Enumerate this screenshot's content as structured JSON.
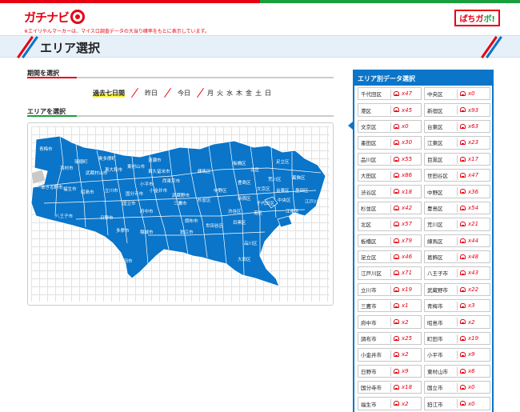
{
  "header": {
    "logo_left": "ガチナビ",
    "notice": "※エイリやんマーカーは、マイスロ調査データの大当り確率をもとに表示しています。",
    "logo_right_a": "ぱちガ",
    "logo_right_b": "ボ!"
  },
  "page_title": "エリア選択",
  "period": {
    "heading": "期間を選択",
    "options": [
      "過去七日間",
      "昨日",
      "今日"
    ],
    "active": "過去七日間",
    "days": [
      "月",
      "火",
      "水",
      "木",
      "金",
      "土",
      "日"
    ]
  },
  "area": {
    "heading": "エリアを選択",
    "map_labels": [
      "青梅市",
      "羽村市",
      "瑞穂町",
      "奥多摩町",
      "武蔵村山市",
      "東大和市",
      "東村山市",
      "清瀬市",
      "東久留米市",
      "あきる野市",
      "福生市",
      "昭島市",
      "立川市",
      "小平市",
      "西東京市",
      "練馬区",
      "板橋区",
      "北区",
      "足立区",
      "葛飾区",
      "荒川区",
      "台東区",
      "墨田区",
      "文京区",
      "豊島区",
      "中野区",
      "杉並区",
      "新宿区",
      "千代田区",
      "中央区",
      "江東区",
      "江戸川区",
      "武蔵野市",
      "三鷹市",
      "小金井市",
      "国分寺市",
      "国立市",
      "府中市",
      "調布市",
      "狛江市",
      "日野市",
      "八王子市",
      "多摩市",
      "稲城市",
      "町田市",
      "世田谷区",
      "渋谷区",
      "目黒区",
      "港区",
      "品川区",
      "大田区"
    ]
  },
  "panel": {
    "title": "エリア別データ選択",
    "items": [
      {
        "name": "千代田区",
        "val": "x47"
      },
      {
        "name": "中央区",
        "val": "x0"
      },
      {
        "name": "港区",
        "val": "x45"
      },
      {
        "name": "新宿区",
        "val": "x93"
      },
      {
        "name": "文京区",
        "val": "x0"
      },
      {
        "name": "台東区",
        "val": "x63"
      },
      {
        "name": "墨田区",
        "val": "x30"
      },
      {
        "name": "江東区",
        "val": "x23"
      },
      {
        "name": "品川区",
        "val": "x55"
      },
      {
        "name": "目黒区",
        "val": "x17"
      },
      {
        "name": "大田区",
        "val": "x86"
      },
      {
        "name": "世田谷区",
        "val": "x47"
      },
      {
        "name": "渋谷区",
        "val": "x18"
      },
      {
        "name": "中野区",
        "val": "x36"
      },
      {
        "name": "杉並区",
        "val": "x42"
      },
      {
        "name": "豊島区",
        "val": "x54"
      },
      {
        "name": "北区",
        "val": "x57"
      },
      {
        "name": "荒川区",
        "val": "x21"
      },
      {
        "name": "板橋区",
        "val": "x79"
      },
      {
        "name": "練馬区",
        "val": "x44"
      },
      {
        "name": "足立区",
        "val": "x46"
      },
      {
        "name": "葛飾区",
        "val": "x48"
      },
      {
        "name": "江戸川区",
        "val": "x71"
      },
      {
        "name": "八王子市",
        "val": "x43"
      },
      {
        "name": "立川市",
        "val": "x19"
      },
      {
        "name": "武蔵野市",
        "val": "x22"
      },
      {
        "name": "三鷹市",
        "val": "x1"
      },
      {
        "name": "青梅市",
        "val": "x3"
      },
      {
        "name": "府中市",
        "val": "x2"
      },
      {
        "name": "昭島市",
        "val": "x2"
      },
      {
        "name": "調布市",
        "val": "x25"
      },
      {
        "name": "町田市",
        "val": "x19"
      },
      {
        "name": "小金井市",
        "val": "x2"
      },
      {
        "name": "小平市",
        "val": "x9"
      },
      {
        "name": "日野市",
        "val": "x9"
      },
      {
        "name": "東村山市",
        "val": "x6"
      },
      {
        "name": "国分寺市",
        "val": "x18"
      },
      {
        "name": "国立市",
        "val": "x0"
      },
      {
        "name": "福生市",
        "val": "x2"
      },
      {
        "name": "狛江市",
        "val": "x0"
      }
    ]
  },
  "colors": {
    "red": "#e60012",
    "green": "#1b9e3e",
    "blue": "#0a75c9"
  }
}
